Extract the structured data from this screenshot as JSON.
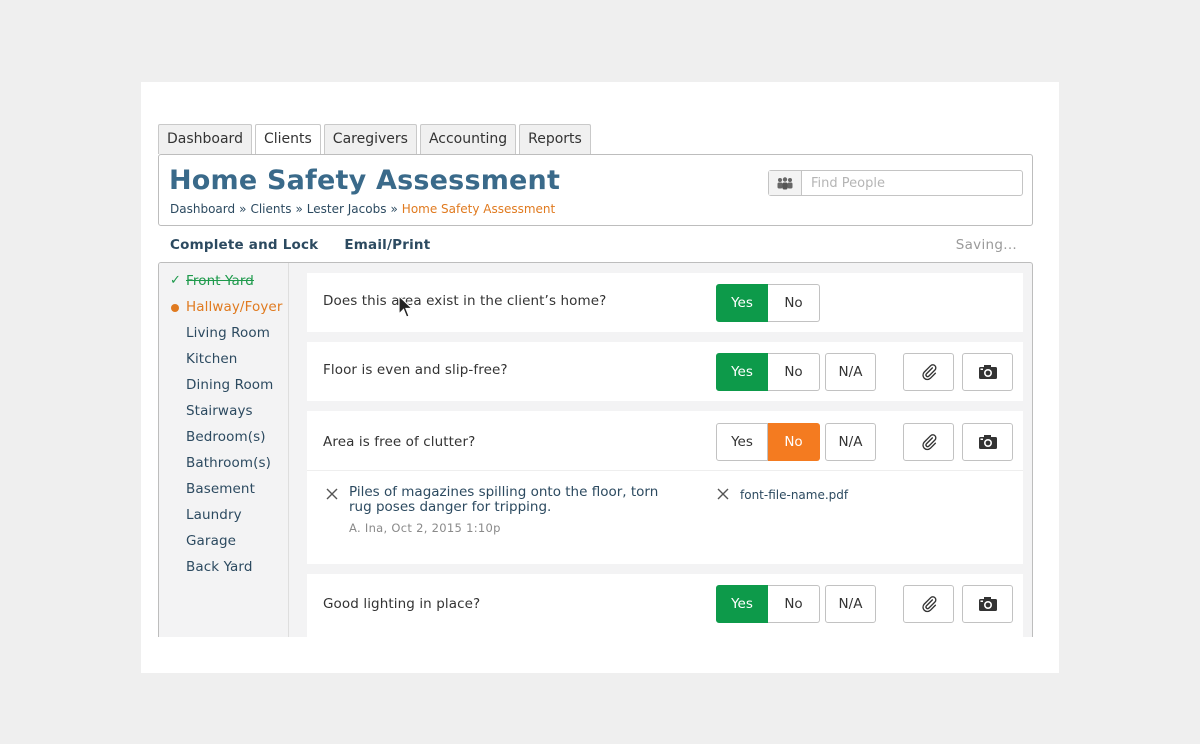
{
  "tabs": [
    "Dashboard",
    "Clients",
    "Caregivers",
    "Accounting",
    "Reports"
  ],
  "header": {
    "title": "Home Safety Assessment",
    "breadcrumb": [
      "Dashboard",
      "Clients",
      "Lester Jacobs",
      "Home Safety Assessment"
    ],
    "breadcrumb_sep": "»"
  },
  "search": {
    "placeholder": "Find People",
    "value": ""
  },
  "actions": {
    "complete": "Complete and Lock",
    "email": "Email/Print"
  },
  "status": {
    "saving": "Saving..."
  },
  "sidebar": {
    "items": [
      {
        "label": "Front Yard",
        "state": "done"
      },
      {
        "label": "Hallway/Foyer",
        "state": "current"
      },
      {
        "label": "Living Room",
        "state": "pending"
      },
      {
        "label": "Kitchen",
        "state": "pending"
      },
      {
        "label": "Dining Room",
        "state": "pending"
      },
      {
        "label": "Stairways",
        "state": "pending"
      },
      {
        "label": "Bedroom(s)",
        "state": "pending"
      },
      {
        "label": "Bathroom(s)",
        "state": "pending"
      },
      {
        "label": "Basement",
        "state": "pending"
      },
      {
        "label": "Laundry",
        "state": "pending"
      },
      {
        "label": "Garage",
        "state": "pending"
      },
      {
        "label": "Back Yard",
        "state": "pending"
      }
    ]
  },
  "buttons": {
    "yes": "Yes",
    "no": "No",
    "na": "N/A"
  },
  "questions": [
    {
      "text": "Does this area exist in the client’s home?",
      "answer": "Yes"
    },
    {
      "text": "Floor is even and slip-free?",
      "answer": "Yes"
    },
    {
      "text": "Area is free of clutter?",
      "answer": "No",
      "note": {
        "text": "Piles of magazines spilling onto the floor, torn rug poses danger for tripping.",
        "meta": "A. Ina, Oct 2, 2015 1:10p"
      },
      "attachment": "font-file-name.pdf"
    },
    {
      "text": "Good lighting in place?",
      "answer": "Yes"
    }
  ],
  "colors": {
    "accent_blue": "#3a6a8a",
    "yes_green": "#0d9a4a",
    "no_orange": "#f47b20",
    "current_orange": "#e07a1f",
    "done_green": "#1e9a4c"
  },
  "icons": [
    "people-icon",
    "paperclip-icon",
    "camera-icon",
    "close-icon",
    "checkmark-icon"
  ]
}
